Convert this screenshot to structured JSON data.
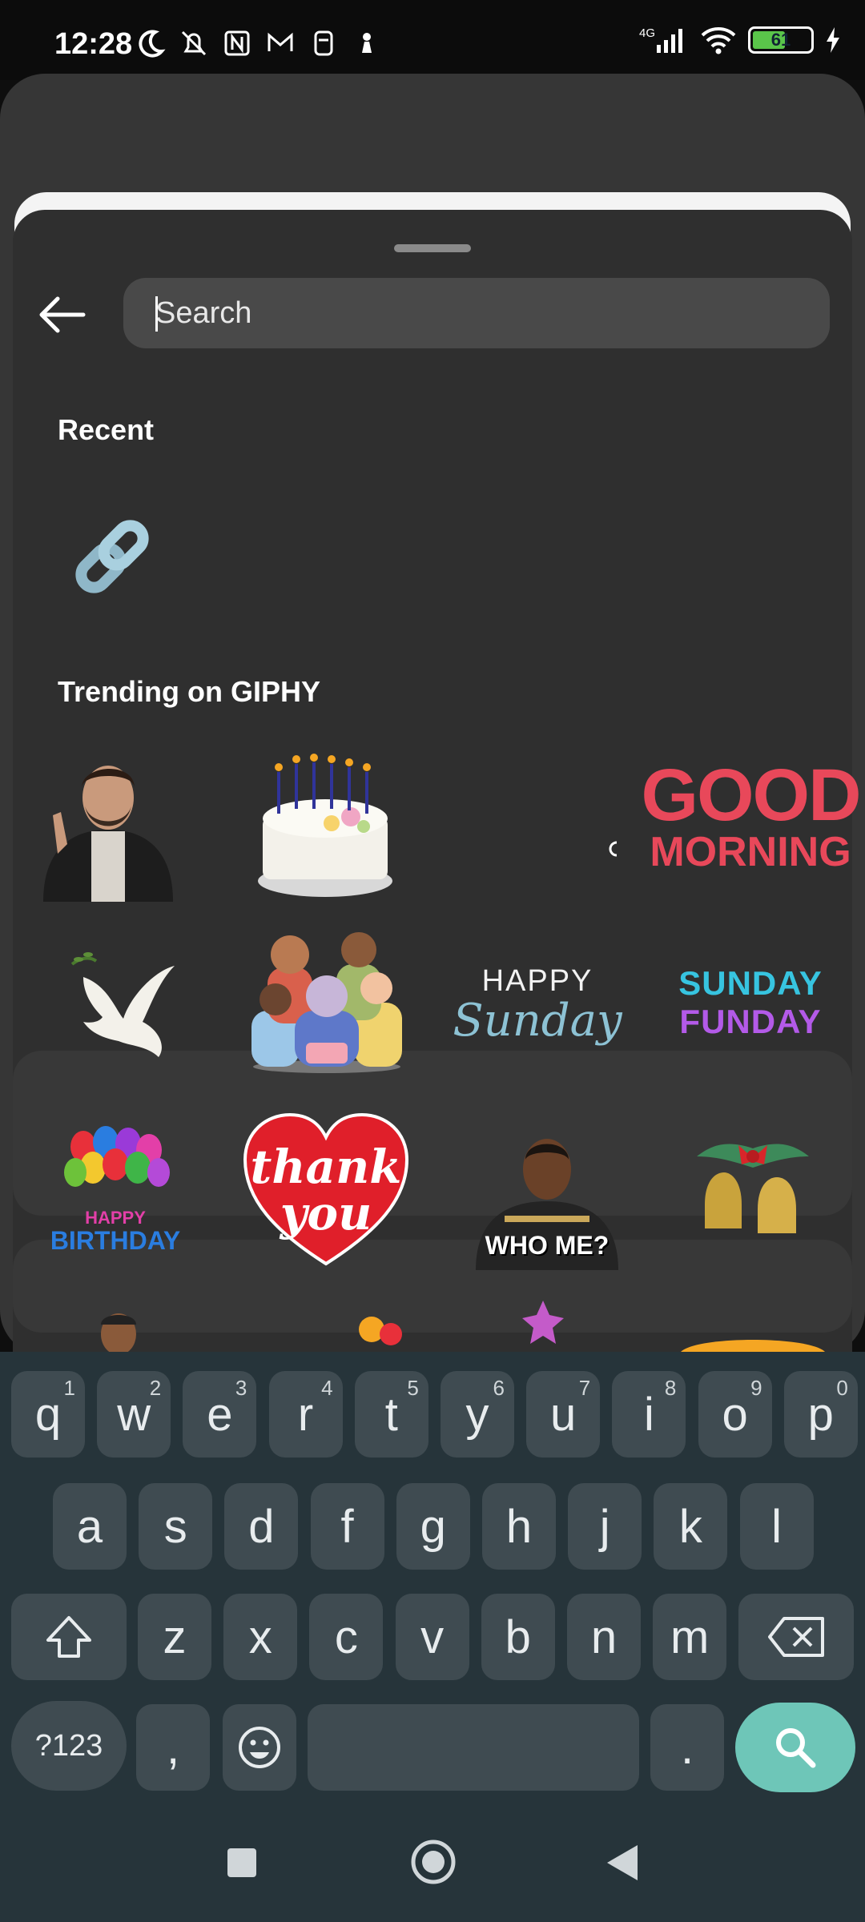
{
  "status_bar": {
    "time": "12:28",
    "network": "4G",
    "battery": "61",
    "battery_percent": 61
  },
  "search": {
    "placeholder": "Search",
    "value": ""
  },
  "sections": {
    "recent_title": "Recent",
    "trending_title": "Trending on GIPHY"
  },
  "stickers": {
    "happy_sunday_line1": "HAPPY",
    "happy_sunday_line2": "Sunday",
    "sunday_funday_line1": "SUNDAY",
    "sunday_funday_line2": "FUNDAY",
    "good_morning_line1": "GOOD",
    "good_morning_line2": "MORNING",
    "thank_you_line1": "thank",
    "thank_you_line2": "you",
    "who_me": "WHO ME?",
    "happy_birthday_line1": "HAPPY",
    "happy_birthday_line2": "BIRTHDAY"
  },
  "keyboard": {
    "row1": [
      {
        "label": "q",
        "hint": "1"
      },
      {
        "label": "w",
        "hint": "2"
      },
      {
        "label": "e",
        "hint": "3"
      },
      {
        "label": "r",
        "hint": "4"
      },
      {
        "label": "t",
        "hint": "5"
      },
      {
        "label": "y",
        "hint": "6"
      },
      {
        "label": "u",
        "hint": "7"
      },
      {
        "label": "i",
        "hint": "8"
      },
      {
        "label": "o",
        "hint": "9"
      },
      {
        "label": "p",
        "hint": "0"
      }
    ],
    "row2": [
      "a",
      "s",
      "d",
      "f",
      "g",
      "h",
      "j",
      "k",
      "l"
    ],
    "row3": [
      "z",
      "x",
      "c",
      "v",
      "b",
      "n",
      "m"
    ],
    "symbols_key": "?123",
    "comma_key": ",",
    "period_key": "."
  },
  "colors": {
    "sheet_bg": "#2f2f2f",
    "search_bg": "#494949",
    "keyboard_bg": "#26343a",
    "key_bg": "#3f4b51",
    "action_key": "#6ec6b8"
  }
}
